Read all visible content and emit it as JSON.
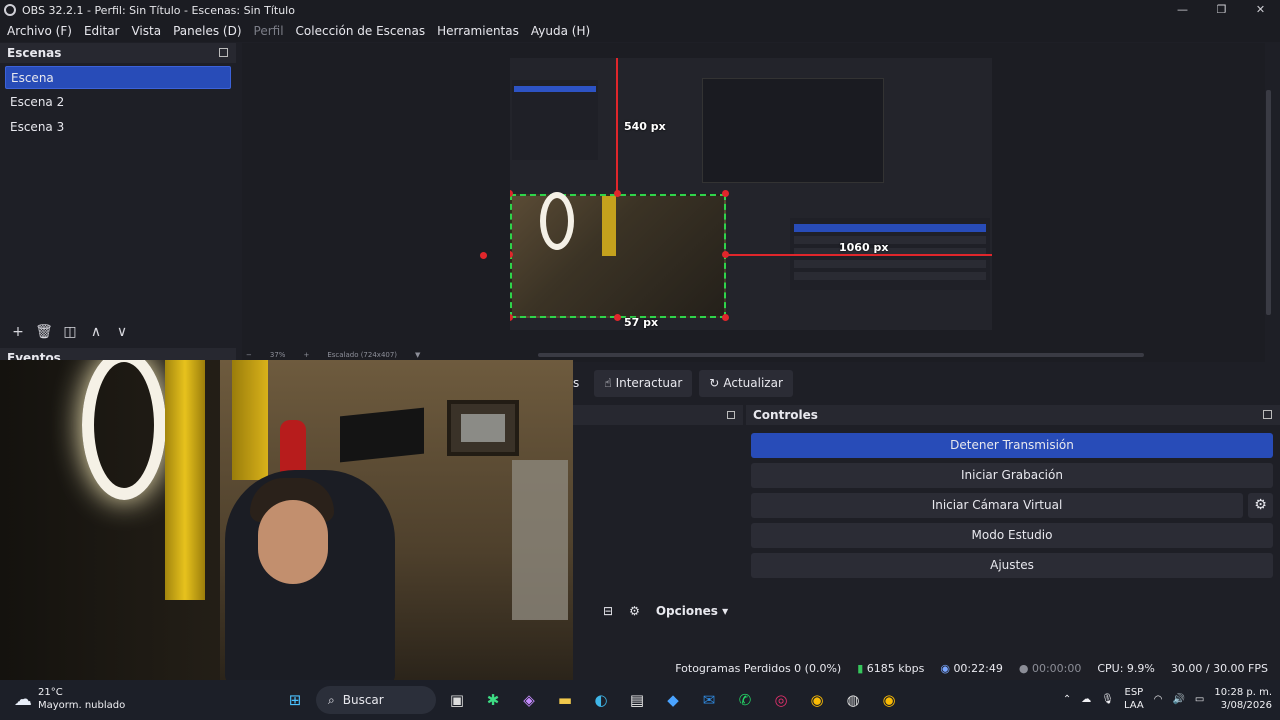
{
  "titlebar": {
    "title": "OBS 32.2.1 - Perfil: Sin Título - Escenas: Sin Título",
    "minimize": "—",
    "maximize": "❐",
    "close": "✕"
  },
  "menu": {
    "items": [
      "Archivo (F)",
      "Editar",
      "Vista",
      "Paneles (D)",
      "Perfil",
      "Colección de Escenas",
      "Herramientas",
      "Ayuda (H)"
    ]
  },
  "scenes": {
    "title": "Escenas",
    "items": [
      {
        "label": "Escena",
        "active": true
      },
      {
        "label": "Escena 2",
        "active": false
      },
      {
        "label": "Escena 3",
        "active": false
      }
    ],
    "toolbar": {
      "add": "+",
      "remove": "🗑",
      "filter": "◫",
      "up": "∧",
      "down": "∨"
    }
  },
  "events": {
    "title": "Eventos"
  },
  "preview": {
    "measure_540": "540 px",
    "measure_1060": "1060 px",
    "measure_57": "57 px",
    "zoom_minus": "−",
    "zoom_value": "37%",
    "zoom_plus": "+",
    "scaling": "Escalado (724x407)"
  },
  "actions": {
    "partial": "s",
    "interact": "Interactuar",
    "refresh": "Actualizar"
  },
  "midpanel": {
    "options": "Opciones"
  },
  "controls": {
    "title": "Controles",
    "stop_stream": "Detener Transmisión",
    "start_recording": "Iniciar Grabación",
    "start_virtualcam": "Iniciar Cámara Virtual",
    "studio_mode": "Modo Estudio",
    "settings": "Ajustes"
  },
  "status": {
    "dropped_frames": "Fotogramas Perdidos 0 (0.0%)",
    "bitrate": "6185 kbps",
    "stream_time": "00:22:49",
    "record_time": "00:00:00",
    "cpu": "CPU: 9.9%",
    "fps": "30.00 / 30.00 FPS"
  },
  "taskbar": {
    "temperature": "21°C",
    "weather": "Mayorm. nublado",
    "search": "Buscar",
    "lang_top": "ESP",
    "lang_bottom": "LAA",
    "time": "10:28 p. m.",
    "date": "3/08/2026"
  },
  "colors": {
    "accent": "#284cb8",
    "recording_green": "#36c75c",
    "selection_red": "#e0262b"
  }
}
